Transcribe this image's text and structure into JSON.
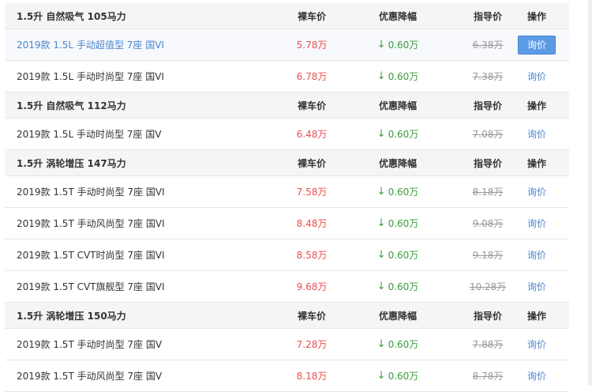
{
  "columns": {
    "price": "裸车价",
    "discount": "优惠降幅",
    "msrp": "指导价",
    "action": "操作"
  },
  "arrow_icon": "↓",
  "colors": {
    "price": "#e84f4f",
    "discount": "#3a9b3a",
    "link": "#4a86cf",
    "button": "#5b9be6"
  },
  "groups": [
    {
      "title": "1.5升 自然吸气 105马力",
      "models": [
        {
          "name": "2019款 1.5L 手动超值型 7座 国VI",
          "price": "5.78万",
          "discount": "0.60万",
          "msrp": "6.38万",
          "action": "询价",
          "highlighted": true
        },
        {
          "name": "2019款 1.5L 手动时尚型 7座 国VI",
          "price": "6.78万",
          "discount": "0.60万",
          "msrp": "7.38万",
          "action": "询价"
        }
      ]
    },
    {
      "title": "1.5升 自然吸气 112马力",
      "models": [
        {
          "name": "2019款 1.5L 手动时尚型 7座 国V",
          "price": "6.48万",
          "discount": "0.60万",
          "msrp": "7.08万",
          "action": "询价"
        }
      ]
    },
    {
      "title": "1.5升 涡轮增压 147马力",
      "models": [
        {
          "name": "2019款 1.5T 手动时尚型 7座 国VI",
          "price": "7.58万",
          "discount": "0.60万",
          "msrp": "8.18万",
          "action": "询价"
        },
        {
          "name": "2019款 1.5T 手动风尚型 7座 国VI",
          "price": "8.48万",
          "discount": "0.60万",
          "msrp": "9.08万",
          "action": "询价"
        },
        {
          "name": "2019款 1.5T CVT时尚型 7座 国VI",
          "price": "8.58万",
          "discount": "0.60万",
          "msrp": "9.18万",
          "action": "询价"
        },
        {
          "name": "2019款 1.5T CVT旗舰型 7座 国VI",
          "price": "9.68万",
          "discount": "0.60万",
          "msrp": "10.28万",
          "action": "询价"
        }
      ]
    },
    {
      "title": "1.5升 涡轮增压 150马力",
      "models": [
        {
          "name": "2019款 1.5T 手动时尚型 7座 国V",
          "price": "7.28万",
          "discount": "0.60万",
          "msrp": "7.88万",
          "action": "询价"
        },
        {
          "name": "2019款 1.5T 手动风尚型 7座 国V",
          "price": "8.18万",
          "discount": "0.60万",
          "msrp": "8.78万",
          "action": "询价"
        }
      ]
    }
  ]
}
